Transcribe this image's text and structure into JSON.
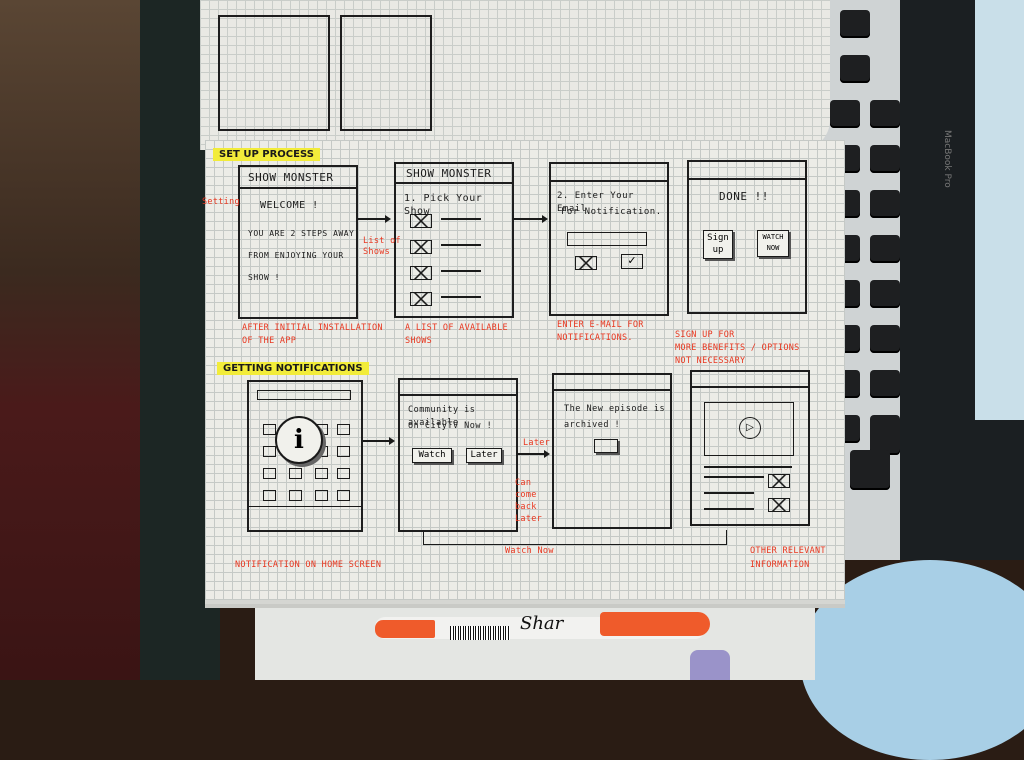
{
  "setup": {
    "heading": "SET UP PROCESS",
    "screen1": {
      "title": "SHOW MONSTER",
      "body": [
        "WELCOME !",
        "YOU ARE 2 STEPS AWAY",
        "FROM ENJOYING YOUR",
        "SHOW !"
      ]
    },
    "screen2": {
      "title": "SHOW MONSTER",
      "body": "1. Pick Your Show"
    },
    "screen3": {
      "body": [
        "2. Enter Your Email",
        "For Notification."
      ]
    },
    "screen4": {
      "title": "DONE !!",
      "btn1": [
        "Sign",
        "up"
      ],
      "btn2": [
        "WATCH",
        "NOW"
      ]
    },
    "notes": {
      "setting": "Setting",
      "list_of_shows": [
        "List of",
        "Shows"
      ],
      "after_install": [
        "AFTER INITIAL INSTALLATION",
        "OF THE APP"
      ],
      "list_available": [
        "A LIST OF AVAILABLE",
        "SHOWS"
      ],
      "enter_email": [
        "ENTER E-MAIL FOR",
        "NOTIFICATIONS."
      ],
      "sign_up_more": [
        "SIGN UP FOR",
        "MORE BENEFITS / OPTIONS",
        "NOT NECESSARY"
      ]
    }
  },
  "notifications": {
    "heading": "GETTING NOTIFICATIONS",
    "screen2": {
      "body": [
        "Community is available",
        "on CityTV  Now !"
      ],
      "btn1": "Watch",
      "btn2": "Later"
    },
    "screen3": {
      "body": [
        "The New episode is",
        "archived !"
      ]
    },
    "notes": {
      "home": "NOTIFICATION ON HOME SCREEN",
      "later": "Later",
      "come_back": [
        "Can",
        "come",
        "back",
        "Later"
      ],
      "watch_now": "Watch  Now",
      "other_info": [
        "OTHER RELEVANT",
        "INFORMATION"
      ]
    }
  },
  "marker_brand": "Shar",
  "laptop_label": "MacBook Pro"
}
